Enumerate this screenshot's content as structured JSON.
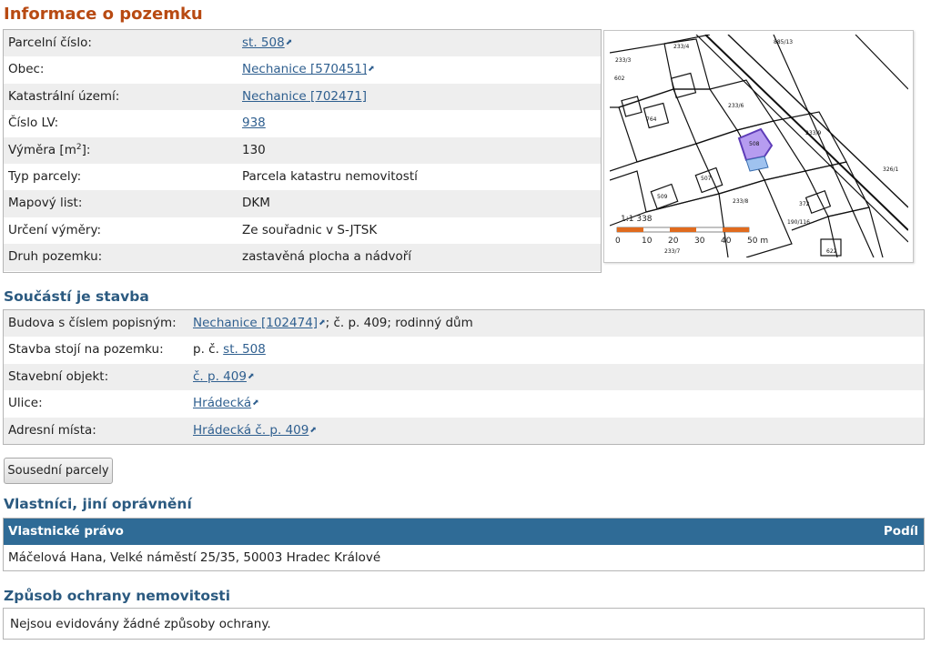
{
  "page_title": "Informace o pozemku",
  "parcel": {
    "rows": [
      {
        "label": "Parcelní číslo:",
        "value": "st. 508",
        "link": true,
        "ext": true
      },
      {
        "label": "Obec:",
        "value": "Nechanice [570451]",
        "link": true,
        "ext": true
      },
      {
        "label": "Katastrální území:",
        "value": "Nechanice [702471]",
        "link": true,
        "ext": false
      },
      {
        "label": "Číslo LV:",
        "value": "938",
        "link": true,
        "ext": false
      },
      {
        "label_pre": "Výměra [m",
        "label_sup": "2",
        "label_post": "]:",
        "value": "130",
        "link": false
      },
      {
        "label": "Typ parcely:",
        "value": "Parcela katastru nemovitostí",
        "link": false
      },
      {
        "label": "Mapový list:",
        "value": "DKM",
        "link": false
      },
      {
        "label": "Určení výměry:",
        "value": "Ze souřadnic v S-JTSK",
        "link": false
      },
      {
        "label": "Druh pozemku:",
        "value": "zastavěná plocha a nádvoří",
        "link": false
      }
    ]
  },
  "map": {
    "scale_text": "1:1 338",
    "scale_ticks": [
      "0",
      "10",
      "20",
      "30",
      "40",
      "50 m"
    ],
    "parcel_numbers": [
      "233/3",
      "233/4",
      "602",
      "764",
      "233/6",
      "507",
      "233/9",
      "508",
      "233/8",
      "372",
      "190/116",
      "622",
      "233/7",
      "885/13",
      "326/1",
      "509"
    ],
    "highlight_color": "#b69cf0",
    "highlight_outline": "#5e3cb8"
  },
  "building": {
    "title": "Součástí je stavba",
    "rows": [
      {
        "label": "Budova s číslem popisným:",
        "link": "Nechanice [102474]",
        "ext": true,
        "suffix": "; č. p. 409; rodinný dům"
      },
      {
        "label": "Stavba stojí na pozemku:",
        "prefix": "p. č. ",
        "link": "st. 508",
        "ext": false
      },
      {
        "label": "Stavební objekt:",
        "link": "č. p. 409",
        "ext": true
      },
      {
        "label": "Ulice:",
        "link": "Hrádecká",
        "ext": true
      },
      {
        "label": "Adresní místa:",
        "link": "Hrádecká č. p. 409",
        "ext": true
      }
    ]
  },
  "neighbors_button": "Sousední parcely",
  "owners": {
    "title": "Vlastníci, jiní oprávnění",
    "col_right": "Vlastnické právo",
    "col_share": "Podíl",
    "owner": "Máčelová Hana, Velké náměstí 25/35, 50003 Hradec Králové"
  },
  "protection": {
    "title": "Způsob ochrany nemovitosti",
    "text": "Nejsou evidovány žádné způsoby ochrany."
  }
}
